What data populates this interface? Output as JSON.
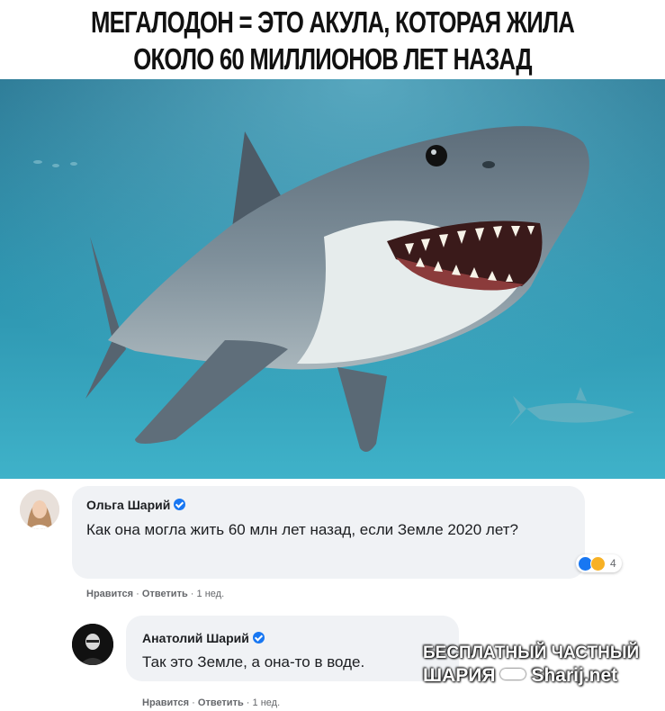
{
  "headline": {
    "line1": "МЕГАЛОДОН = ЭТО АКУЛА, КОТОРАЯ ЖИЛА",
    "line2": "ОКОЛО 60 МИЛЛИОНОВ ЛЕТ НАЗАД"
  },
  "comment1": {
    "author": "Ольга Шарий",
    "text": "Как она могла жить 60 млн лет назад, если Земле 2020 лет?",
    "reaction_count": "4",
    "like_label": "Нравится",
    "reply_label": "Ответить",
    "time": "1 нед."
  },
  "comment2": {
    "author": "Анатолий Шарий",
    "text": "Так это Земле, а она-то в воде.",
    "like_label": "Нравится",
    "reply_label": "Ответить",
    "time": "1 нед."
  },
  "watermark": {
    "line1": "БЕСПЛАТНЫЙ ЧАСТНЫЙ",
    "line2a": "ШАРИЯ",
    "line2b": "Sharij.net"
  },
  "colors": {
    "water_top": "#1d6a87",
    "water_bottom": "#3fb2c9",
    "shark_body": "#6f7f8c",
    "shark_belly": "#e6ecec",
    "bubble": "#f0f2f5",
    "verified": "#1877f2",
    "meta_text": "#65676b"
  }
}
